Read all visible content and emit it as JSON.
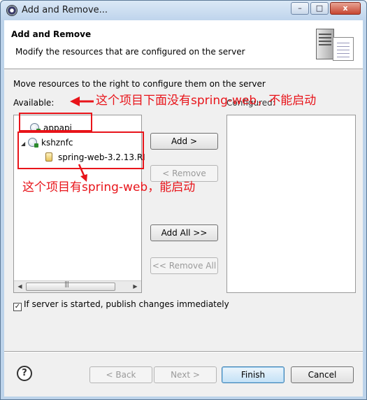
{
  "window": {
    "title": "Add and Remove...",
    "min_label": "–",
    "max_label": "□",
    "close_label": "x"
  },
  "header": {
    "title": "Add and Remove",
    "description": "Modify the resources that are configured on the server"
  },
  "main": {
    "instruction": "Move resources to the right to configure them on the server",
    "available_label": "Available:",
    "configured_label": "Configured:",
    "available_items": [
      {
        "label": "appapi",
        "type": "project"
      },
      {
        "label": "kshznfc",
        "type": "project",
        "expanded": true
      },
      {
        "label": "spring-web-3.2.13.RI",
        "type": "jar"
      }
    ],
    "buttons": {
      "add": "Add >",
      "remove": "< Remove",
      "add_all": "Add All >>",
      "remove_all": "<< Remove All"
    },
    "publish_checkbox": {
      "label": "If server is started, publish changes immediately",
      "checked": true
    }
  },
  "footer": {
    "help_label": "?",
    "back": "< Back",
    "next": "Next >",
    "finish": "Finish",
    "cancel": "Cancel"
  },
  "annotations": {
    "note_1": "这个项目下面没有spring-web，不能启动",
    "note_2": "这个项目有spring-web，能启动",
    "color": "#e8141a"
  }
}
